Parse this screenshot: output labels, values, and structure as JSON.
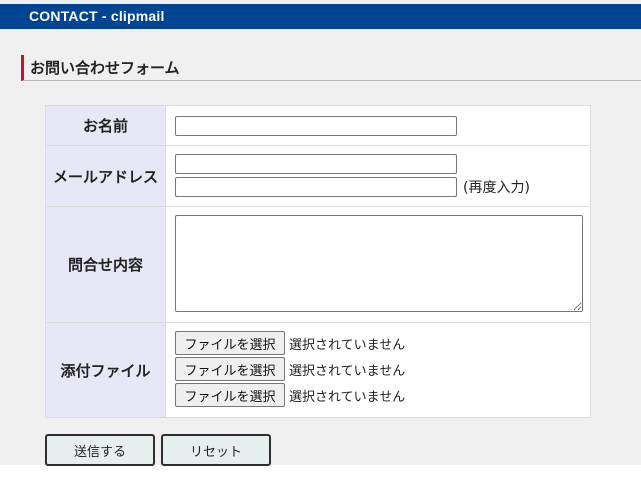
{
  "header": {
    "title": "CONTACT - clipmail"
  },
  "section": {
    "title": "お問い合わせフォーム"
  },
  "form": {
    "name_label": "お名前",
    "email_label": "メールアドレス",
    "email_confirm_note": "(再度入力)",
    "message_label": "問合せ内容",
    "attach_label": "添付ファイル",
    "file_inputs": [
      {
        "button": "ファイルを選択",
        "status": "選択されていません"
      },
      {
        "button": "ファイルを選択",
        "status": "選択されていません"
      },
      {
        "button": "ファイルを選択",
        "status": "選択されていません"
      }
    ]
  },
  "actions": {
    "submit_label": "送信する",
    "reset_label": "リセット"
  },
  "colors": {
    "header_bg": "#004494",
    "accent_bar": "#c8102e",
    "label_bg": "#e7e7f8"
  }
}
